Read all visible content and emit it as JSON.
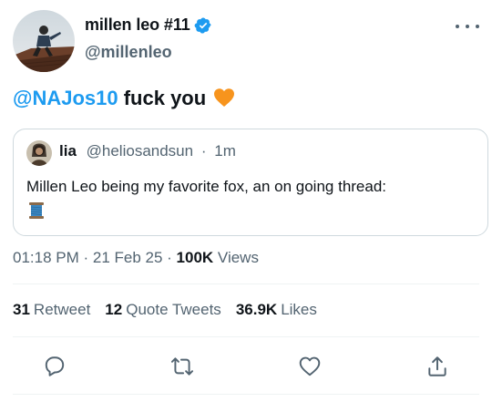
{
  "author": {
    "display_name": "millen leo #11",
    "handle": "@millenleo",
    "verified": true
  },
  "tweet": {
    "mention": "@NAJos10",
    "text": " fuck you",
    "emoji": "orange-heart"
  },
  "quote": {
    "name": "lia",
    "handle": "@heliosandsun",
    "separator": "·",
    "age": "1m",
    "text": "Millen Leo being my favorite fox, an on going thread:",
    "emoji": "spool-of-thread"
  },
  "meta": {
    "time": "01:18 PM",
    "dot1": " · ",
    "date": "21 Feb 25",
    "dot2": " · ",
    "views_count": "100K",
    "views_label": "Views"
  },
  "stats": {
    "retweets_count": "31",
    "retweets_label": "Retweet",
    "quotes_count": "12",
    "quotes_label": "Quote Tweets",
    "likes_count": "36.9K",
    "likes_label": "Likes"
  },
  "colors": {
    "accent": "#1d9bf0",
    "text": "#0f1419",
    "secondary": "#536471",
    "border": "#cfd9de",
    "divider": "#eff3f4",
    "heart": "#f7941d"
  },
  "actions": [
    "reply-icon",
    "retweet-icon",
    "like-icon",
    "share-icon"
  ]
}
